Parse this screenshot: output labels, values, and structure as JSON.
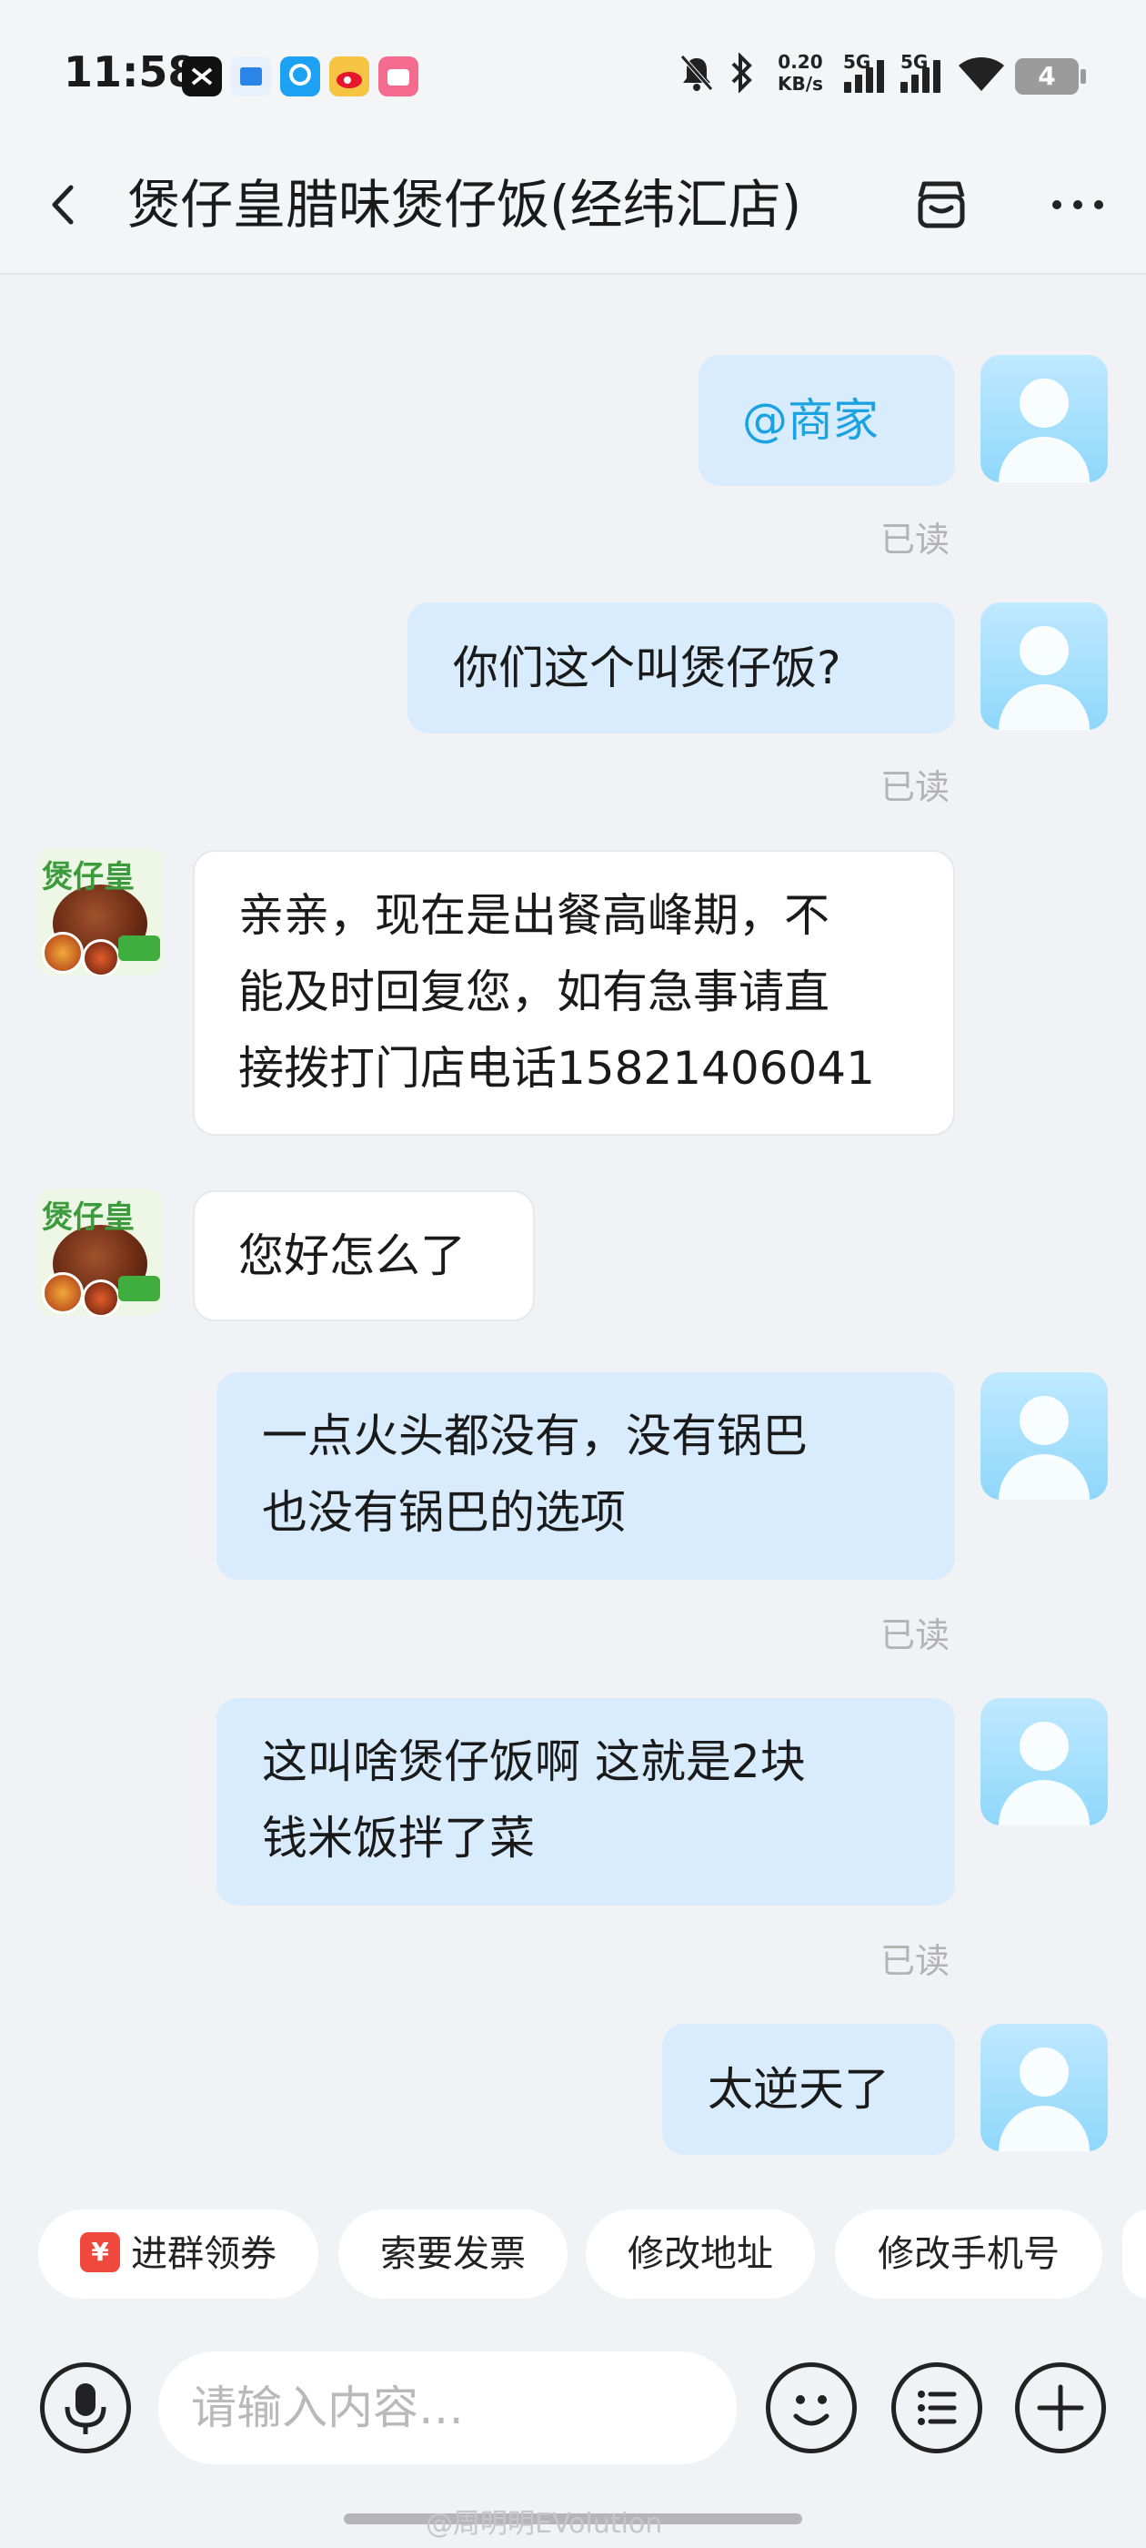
{
  "status_bar": {
    "time": "11:58",
    "net_speed_value": "0.20",
    "net_speed_unit": "KB/s",
    "signal_1_label": "5G",
    "signal_2_label": "5G",
    "battery": "4"
  },
  "header": {
    "title": "煲仔皇腊味煲仔饭(经纬汇店)"
  },
  "messages": [
    {
      "side": "right",
      "text": "@商家",
      "read": "已读"
    },
    {
      "side": "right",
      "text": "你们这个叫煲仔饭?",
      "read": "已读"
    },
    {
      "side": "left",
      "lines": [
        "亲亲，现在是出餐高峰期，不",
        "能及时回复您，如有急事请直",
        "接拨打门店电话15821406041"
      ]
    },
    {
      "side": "left",
      "text": "您好怎么了"
    },
    {
      "side": "right",
      "lines": [
        "一点火头都没有，没有锅巴",
        "也没有锅巴的选项"
      ],
      "read": "已读"
    },
    {
      "side": "right",
      "lines": [
        "这叫啥煲仔饭啊 这就是2块",
        "钱米饭拌了菜"
      ],
      "read": "已读"
    },
    {
      "side": "right",
      "text": "太逆天了"
    }
  ],
  "shop_avatar_name": "煲仔皇",
  "quick_actions": {
    "coupon_glyph": "¥",
    "items": [
      "进群领券",
      "索要发票",
      "修改地址",
      "修改手机号"
    ]
  },
  "input": {
    "placeholder": "请输入内容…"
  },
  "watermark": "@周明明EVolution",
  "accent_color": "#1aa3e0"
}
